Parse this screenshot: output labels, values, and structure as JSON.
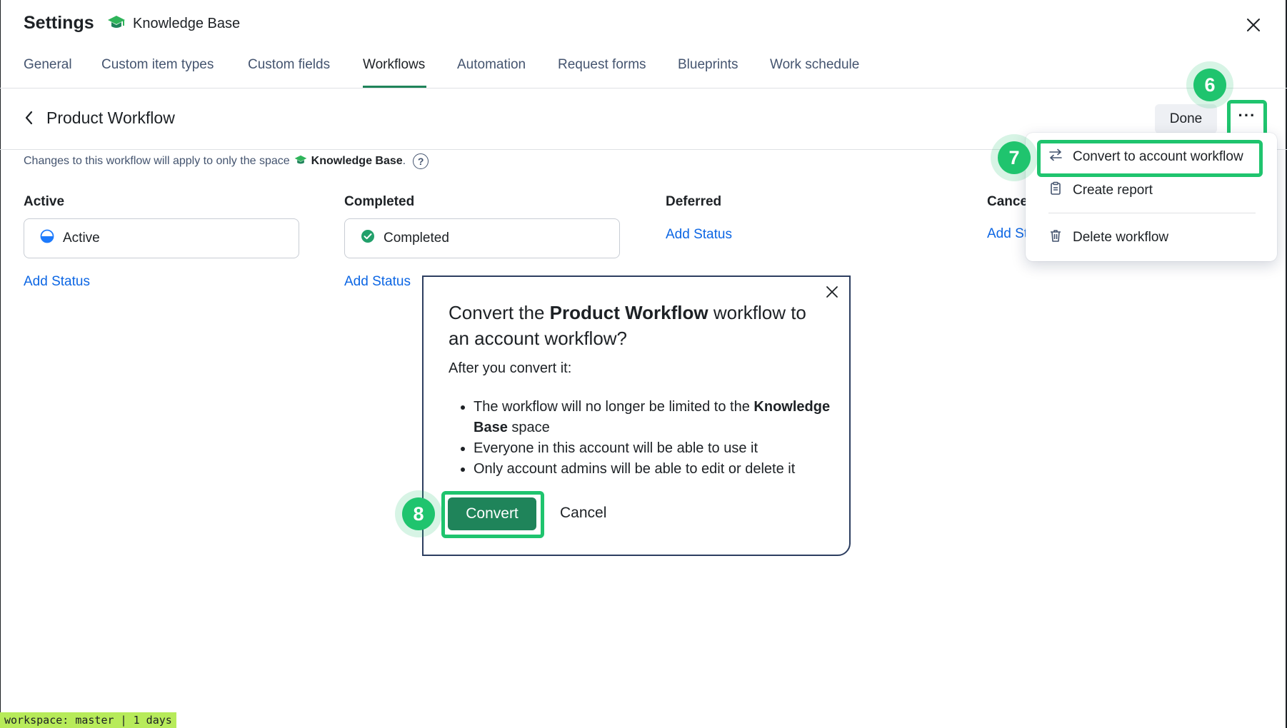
{
  "header": {
    "title": "Settings",
    "space_icon": "graduation-cap-icon",
    "space_name": "Knowledge Base",
    "close_icon": "close-icon"
  },
  "tabs": [
    {
      "label": "General"
    },
    {
      "label": "Custom item types"
    },
    {
      "label": "Custom fields"
    },
    {
      "label": "Workflows",
      "active": true
    },
    {
      "label": "Automation"
    },
    {
      "label": "Request forms"
    },
    {
      "label": "Blueprints"
    },
    {
      "label": "Work schedule"
    }
  ],
  "workflow": {
    "title": "Product Workflow",
    "done_label": "Done",
    "more_label": "···",
    "scope_prefix": "Changes to this workflow will apply to only the space",
    "scope_space": "Knowledge Base",
    "scope_suffix": ".",
    "help_label": "?"
  },
  "columns": [
    {
      "heading": "Active",
      "card": "Active",
      "add_label": "Add Status"
    },
    {
      "heading": "Completed",
      "card": "Completed",
      "add_label": "Add Status"
    },
    {
      "heading": "Deferred",
      "add_label": "Add Status"
    },
    {
      "heading": "Cance",
      "add_label": "Add St"
    }
  ],
  "menu": {
    "items": [
      {
        "label": "Convert to account workflow",
        "icon": "swap-arrows-icon"
      },
      {
        "label": "Create report",
        "icon": "clipboard-icon"
      },
      {
        "label": "Delete workflow",
        "icon": "trash-icon"
      }
    ]
  },
  "modal": {
    "title_prefix": "Convert the ",
    "title_bold": "Product Workflow",
    "title_suffix": " workflow to an account workflow?",
    "subtitle": "After you convert it:",
    "bullet1_prefix": "The workflow will no longer be limited to the ",
    "bullet1_bold": "Knowledge Base",
    "bullet1_suffix": " space",
    "bullet2": "Everyone in this account will be able to use it",
    "bullet3": "Only account admins will be able to edit or delete it",
    "convert_label": "Convert",
    "cancel_label": "Cancel"
  },
  "steps": {
    "six": "6",
    "seven": "7",
    "eight": "8"
  },
  "footer": {
    "workspace": "workspace: master | 1 days"
  },
  "colors": {
    "accent_green": "#1f845a",
    "highlight_green": "#1fc46e",
    "link_blue": "#0c66e4"
  }
}
